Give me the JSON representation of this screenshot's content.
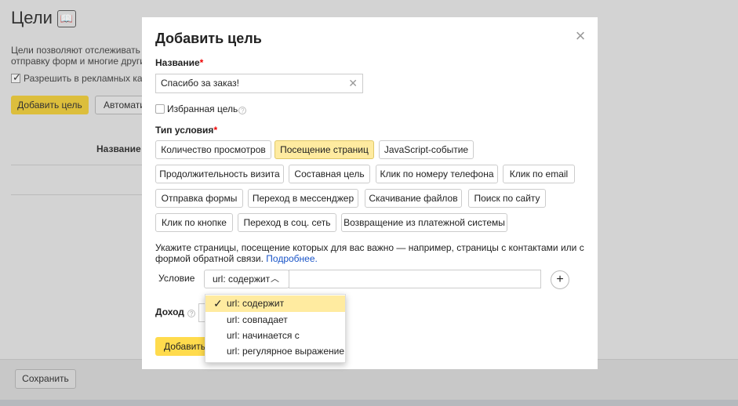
{
  "background": {
    "title": "Цели",
    "description": "Цели позволяют отслеживать ва… отправку форм и многие другие…",
    "description_line1": "Цели позволяют отслеживать ва",
    "description_line2": "отправку форм и многие другие",
    "checkbox_label": "Разрешить в рекламных камп",
    "add_goal_button": "Добавить цель",
    "auto_button": "Автомати",
    "column_header": "Название ц",
    "save_button": "Сохранить"
  },
  "modal": {
    "title": "Добавить цель",
    "name_label": "Название",
    "name_value": "Спасибо за заказ!",
    "favorite_label": "Избранная цель",
    "condition_type_label": "Тип условия",
    "condition_types": [
      "Количество просмотров",
      "Посещение страниц",
      "JavaScript-событие",
      "Продолжительность визита",
      "Составная цель",
      "Клик по номеру телефона",
      "Клик по email",
      "Отправка формы",
      "Переход в мессенджер",
      "Скачивание файлов",
      "Поиск по сайту",
      "Клик по кнопке",
      "Переход в соц. сеть",
      "Возвращение из платежной системы"
    ],
    "active_condition_type": "Посещение страниц",
    "hint_text": "Укажите страницы, посещение которых для вас важно — например, страницы с контактами или с формой обратной связи.",
    "hint_link": "Подробнее.",
    "condition_label": "Условие",
    "condition_selected": "url: содержит",
    "condition_value": "",
    "income_label": "Доход",
    "add_button": "Добавить"
  },
  "dropdown": {
    "options": [
      "url: содержит",
      "url: совпадает",
      "url: начинается с",
      "url: регулярное выражение"
    ],
    "selected": "url: содержит"
  },
  "colors": {
    "accent_yellow": "#ffdb4d",
    "active_chip": "#ffeba0",
    "link": "#1a55c8",
    "required": "#e00000"
  }
}
